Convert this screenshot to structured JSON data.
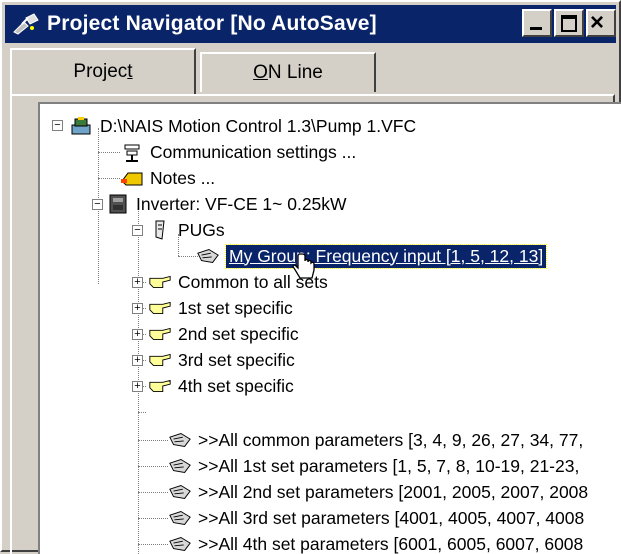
{
  "window": {
    "title": "Project Navigator [No AutoSave]",
    "minimize_label": "_",
    "maximize_label": "□",
    "close_label": "×"
  },
  "tabs": [
    {
      "label_pre": "Projec",
      "label_key": "t",
      "label_post": "",
      "active": true
    },
    {
      "label_pre": "",
      "label_key": "O",
      "label_post": "N Line",
      "active": false
    }
  ],
  "tree": {
    "root": "D:\\NAIS Motion Control 1.3\\Pump 1.VFC",
    "communication": "Communication settings ...",
    "notes": "Notes ...",
    "inverter": "Inverter: VF-CE 1~ 0.25kW",
    "pugs": "PUGs",
    "my_group": "My Group: Frequency input [1, 5, 12, 13]",
    "sets": [
      "Common to all sets",
      "1st set specific",
      "2nd set specific",
      "3rd set specific",
      "4th set specific"
    ],
    "all_params": [
      ">>All common parameters [3, 4, 9, 26, 27, 34, 77,",
      ">>All 1st set parameters [1, 5, 7, 8, 10-19, 21-23,",
      ">>All 2nd set parameters [2001, 2005, 2007, 2008",
      ">>All 3rd set parameters [4001, 4005, 4007, 4008",
      ">>All 4th set parameters [6001, 6005, 6007, 6008"
    ]
  },
  "colors": {
    "titlebar": "#0a246a",
    "selection": "#0a246a",
    "face": "#d4d0c8"
  }
}
